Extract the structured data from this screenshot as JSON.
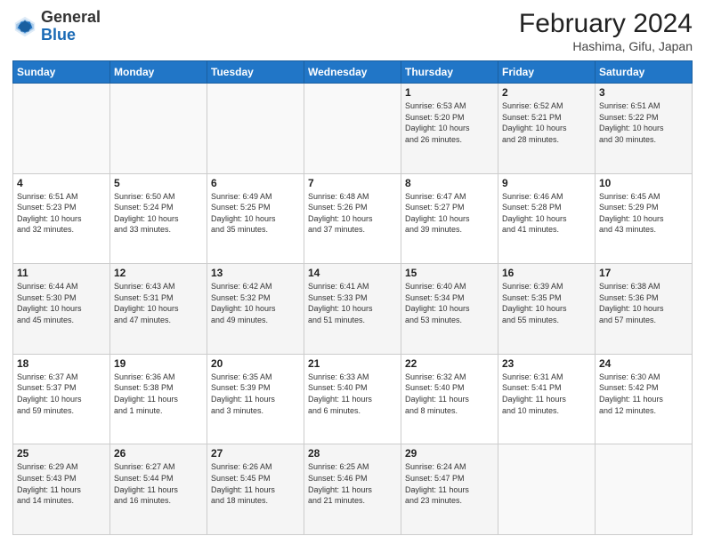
{
  "header": {
    "logo_general": "General",
    "logo_blue": "Blue",
    "month_year": "February 2024",
    "location": "Hashima, Gifu, Japan"
  },
  "weekdays": [
    "Sunday",
    "Monday",
    "Tuesday",
    "Wednesday",
    "Thursday",
    "Friday",
    "Saturday"
  ],
  "weeks": [
    [
      {
        "day": "",
        "info": ""
      },
      {
        "day": "",
        "info": ""
      },
      {
        "day": "",
        "info": ""
      },
      {
        "day": "",
        "info": ""
      },
      {
        "day": "1",
        "info": "Sunrise: 6:53 AM\nSunset: 5:20 PM\nDaylight: 10 hours\nand 26 minutes."
      },
      {
        "day": "2",
        "info": "Sunrise: 6:52 AM\nSunset: 5:21 PM\nDaylight: 10 hours\nand 28 minutes."
      },
      {
        "day": "3",
        "info": "Sunrise: 6:51 AM\nSunset: 5:22 PM\nDaylight: 10 hours\nand 30 minutes."
      }
    ],
    [
      {
        "day": "4",
        "info": "Sunrise: 6:51 AM\nSunset: 5:23 PM\nDaylight: 10 hours\nand 32 minutes."
      },
      {
        "day": "5",
        "info": "Sunrise: 6:50 AM\nSunset: 5:24 PM\nDaylight: 10 hours\nand 33 minutes."
      },
      {
        "day": "6",
        "info": "Sunrise: 6:49 AM\nSunset: 5:25 PM\nDaylight: 10 hours\nand 35 minutes."
      },
      {
        "day": "7",
        "info": "Sunrise: 6:48 AM\nSunset: 5:26 PM\nDaylight: 10 hours\nand 37 minutes."
      },
      {
        "day": "8",
        "info": "Sunrise: 6:47 AM\nSunset: 5:27 PM\nDaylight: 10 hours\nand 39 minutes."
      },
      {
        "day": "9",
        "info": "Sunrise: 6:46 AM\nSunset: 5:28 PM\nDaylight: 10 hours\nand 41 minutes."
      },
      {
        "day": "10",
        "info": "Sunrise: 6:45 AM\nSunset: 5:29 PM\nDaylight: 10 hours\nand 43 minutes."
      }
    ],
    [
      {
        "day": "11",
        "info": "Sunrise: 6:44 AM\nSunset: 5:30 PM\nDaylight: 10 hours\nand 45 minutes."
      },
      {
        "day": "12",
        "info": "Sunrise: 6:43 AM\nSunset: 5:31 PM\nDaylight: 10 hours\nand 47 minutes."
      },
      {
        "day": "13",
        "info": "Sunrise: 6:42 AM\nSunset: 5:32 PM\nDaylight: 10 hours\nand 49 minutes."
      },
      {
        "day": "14",
        "info": "Sunrise: 6:41 AM\nSunset: 5:33 PM\nDaylight: 10 hours\nand 51 minutes."
      },
      {
        "day": "15",
        "info": "Sunrise: 6:40 AM\nSunset: 5:34 PM\nDaylight: 10 hours\nand 53 minutes."
      },
      {
        "day": "16",
        "info": "Sunrise: 6:39 AM\nSunset: 5:35 PM\nDaylight: 10 hours\nand 55 minutes."
      },
      {
        "day": "17",
        "info": "Sunrise: 6:38 AM\nSunset: 5:36 PM\nDaylight: 10 hours\nand 57 minutes."
      }
    ],
    [
      {
        "day": "18",
        "info": "Sunrise: 6:37 AM\nSunset: 5:37 PM\nDaylight: 10 hours\nand 59 minutes."
      },
      {
        "day": "19",
        "info": "Sunrise: 6:36 AM\nSunset: 5:38 PM\nDaylight: 11 hours\nand 1 minute."
      },
      {
        "day": "20",
        "info": "Sunrise: 6:35 AM\nSunset: 5:39 PM\nDaylight: 11 hours\nand 3 minutes."
      },
      {
        "day": "21",
        "info": "Sunrise: 6:33 AM\nSunset: 5:40 PM\nDaylight: 11 hours\nand 6 minutes."
      },
      {
        "day": "22",
        "info": "Sunrise: 6:32 AM\nSunset: 5:40 PM\nDaylight: 11 hours\nand 8 minutes."
      },
      {
        "day": "23",
        "info": "Sunrise: 6:31 AM\nSunset: 5:41 PM\nDaylight: 11 hours\nand 10 minutes."
      },
      {
        "day": "24",
        "info": "Sunrise: 6:30 AM\nSunset: 5:42 PM\nDaylight: 11 hours\nand 12 minutes."
      }
    ],
    [
      {
        "day": "25",
        "info": "Sunrise: 6:29 AM\nSunset: 5:43 PM\nDaylight: 11 hours\nand 14 minutes."
      },
      {
        "day": "26",
        "info": "Sunrise: 6:27 AM\nSunset: 5:44 PM\nDaylight: 11 hours\nand 16 minutes."
      },
      {
        "day": "27",
        "info": "Sunrise: 6:26 AM\nSunset: 5:45 PM\nDaylight: 11 hours\nand 18 minutes."
      },
      {
        "day": "28",
        "info": "Sunrise: 6:25 AM\nSunset: 5:46 PM\nDaylight: 11 hours\nand 21 minutes."
      },
      {
        "day": "29",
        "info": "Sunrise: 6:24 AM\nSunset: 5:47 PM\nDaylight: 11 hours\nand 23 minutes."
      },
      {
        "day": "",
        "info": ""
      },
      {
        "day": "",
        "info": ""
      }
    ]
  ]
}
